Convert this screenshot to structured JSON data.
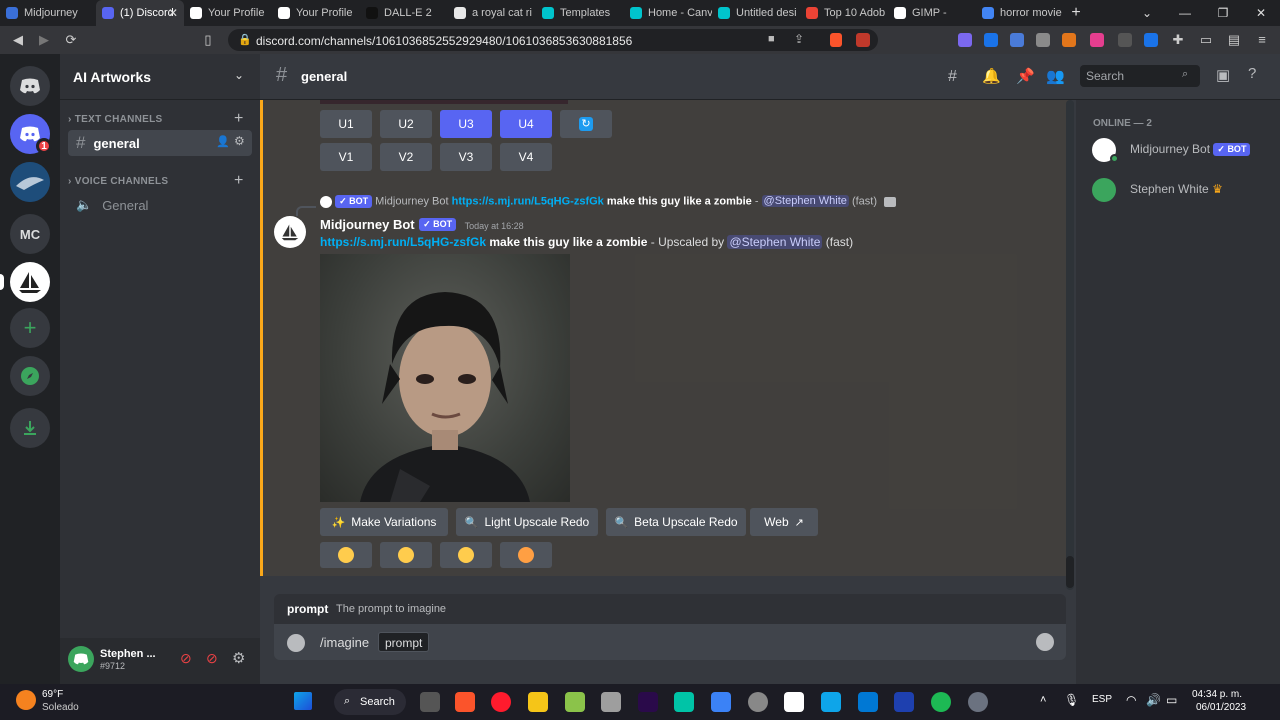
{
  "browser": {
    "tabs": [
      {
        "title": "Midjourney",
        "color": "#3a6fd8",
        "active": false
      },
      {
        "title": "(1) Discord",
        "color": "#5865f2",
        "active": true
      },
      {
        "title": "Your Profile",
        "color": "#ffffff",
        "active": false
      },
      {
        "title": "Your Profile",
        "color": "#ffffff",
        "active": false
      },
      {
        "title": "DALL-E 2",
        "color": "#111111",
        "active": false
      },
      {
        "title": "a royal cat ri",
        "color": "#e8e8e8",
        "active": false
      },
      {
        "title": "Templates",
        "color": "#00c4cc",
        "active": false
      },
      {
        "title": "Home - Canv",
        "color": "#00c4cc",
        "active": false
      },
      {
        "title": "Untitled desi",
        "color": "#00c4cc",
        "active": false
      },
      {
        "title": "Top 10 Adob",
        "color": "#ea4335",
        "active": false
      },
      {
        "title": "GIMP - ",
        "color": "#ffffff",
        "active": false
      },
      {
        "title": "horror movie",
        "color": "#4285f4",
        "active": false
      }
    ],
    "url": "discord.com/channels/1061036852552929480/1061036853630881856"
  },
  "servers": {
    "home_icon": "discord-logo-icon",
    "notification_badge": "1",
    "mc_label": "MC"
  },
  "sidebar": {
    "server_name": "AI Artworks",
    "text_category": "TEXT CHANNELS",
    "voice_category": "VOICE CHANNELS",
    "text_channel": "general",
    "voice_channel": "General"
  },
  "user": {
    "name": "Stephen ...",
    "tag": "#9712"
  },
  "header": {
    "channel": "general",
    "search_placeholder": "Search"
  },
  "upscale_buttons": [
    "U1",
    "U2",
    "U3",
    "U4"
  ],
  "variation_buttons": [
    "V1",
    "V2",
    "V3",
    "V4"
  ],
  "message": {
    "reply_author": "Midjourney Bot",
    "reply_link": "https://s.mj.run/L5qHG-zsfGk",
    "reply_prompt": "make this guy like a zombie",
    "reply_sep": "-",
    "reply_mention": "@Stephen White",
    "reply_speed": "(fast)",
    "author": "Midjourney Bot",
    "bot_tag": "BOT",
    "timestamp": "Today at 16:28",
    "link": "https://s.mj.run/L5qHG-zsfGk",
    "prompt": "make this guy like a zombie",
    "upscaled_by": "- Upscaled by",
    "mention": "@Stephen White",
    "speed": "(fast)"
  },
  "actions": {
    "make_variations": "Make Variations",
    "light_upscale": "Light Upscale Redo",
    "beta_upscale": "Beta Upscale Redo",
    "web": "Web"
  },
  "command": {
    "hint_name": "prompt",
    "hint_desc": "The prompt to imagine",
    "command": "/imagine",
    "param": "prompt"
  },
  "members": {
    "header": "ONLINE — 2",
    "list": [
      {
        "name": "Midjourney Bot",
        "bot": "BOT"
      },
      {
        "name": "Stephen White",
        "crown": "♛"
      }
    ]
  },
  "taskbar": {
    "weather_temp": "69°F",
    "weather_desc": "Soleado",
    "search_label": "Search",
    "lang": "ESP",
    "time": "04:34 p. m.",
    "date": "06/01/2023"
  }
}
